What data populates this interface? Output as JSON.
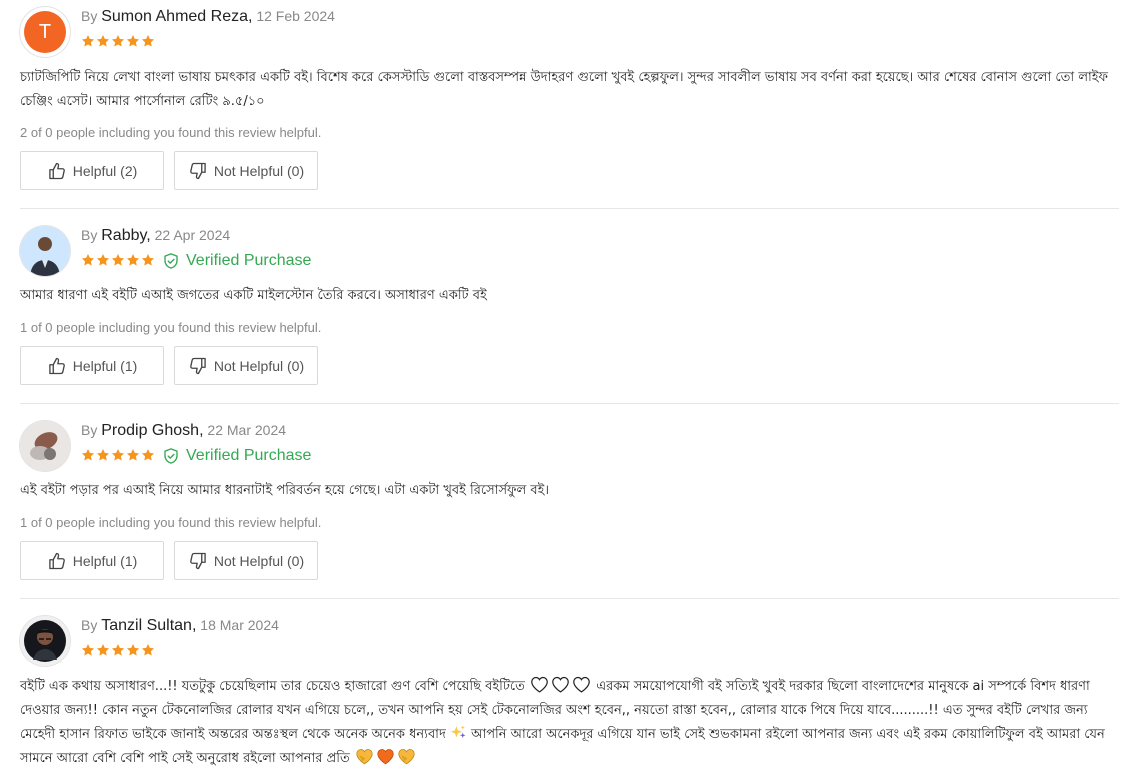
{
  "reviews": [
    {
      "avatar_initial": "T",
      "avatar_color": "#f26522",
      "by": "By",
      "name": "Sumon Ahmed Reza,",
      "date": "12 Feb 2024",
      "rating": 5,
      "verified": "",
      "text": "চ্যাটজিপিটি নিয়ে লেখা বাংলা ভাষায় চমৎকার একটি বই। বিশেষ করে কেসস্টাডি গুলো বাস্তবসম্পন্ন উদাহরণ গুলো খুবই হেল্পফুল। সুন্দর সাবলীল ভাষায় সব বর্ণনা করা হয়েছে। আর শেষের বোনাস গুলো তো লাইফ চেঞ্জিং এসেট। আমার পার্সোনাল রেটিং ৯.৫/১০",
      "helpful_summary": "2 of 0 people including you found this review helpful.",
      "helpful_label": "Helpful (2)",
      "not_helpful_label": "Not Helpful (0)"
    },
    {
      "avatar_initial": "",
      "by": "By",
      "name": "Rabby,",
      "date": "22 Apr 2024",
      "rating": 5,
      "verified": "Verified Purchase",
      "text": "আমার ধারণা এই বইটি এআই জগতের একটি মাইলস্টোন তৈরি করবে। অসাধারণ একটি বই",
      "helpful_summary": "1 of 0 people including you found this review helpful.",
      "helpful_label": "Helpful (1)",
      "not_helpful_label": "Not Helpful (0)"
    },
    {
      "avatar_initial": "",
      "by": "By",
      "name": "Prodip Ghosh,",
      "date": "22 Mar 2024",
      "rating": 5,
      "verified": "Verified Purchase",
      "text": "এই বইটা পড়ার পর এআই নিয়ে আমার ধারনাটাই পরিবর্তন হয়ে গেছে। এটা একটা খুবই রিসোর্সফুল বই।",
      "helpful_summary": "1 of 0 people including you found this review helpful.",
      "helpful_label": "Helpful (1)",
      "not_helpful_label": "Not Helpful (0)"
    },
    {
      "avatar_initial": "",
      "by": "By",
      "name": "Tanzil Sultan,",
      "date": "18 Mar 2024",
      "rating": 5,
      "verified": "",
      "text_part1": "বইটি এক কথায় অসাধারণ...!! যতটুকু চেয়েছিলাম তার চেয়েও হাজারো গুণ বেশি পেয়েছি বইটিতে",
      "text_part2": "এরকম সময়োপযোগী বই সত্যিই খুবই দরকার ছিলো বাংলাদেশের মানুষকে ai সম্পর্কে বিশদ ধারণা দেওয়ার জন্য!! কোন নতুন টেকনোলজির রোলার যখন এগিয়ে চলে,, তখন আপনি হয় সেই টেকনোলজির অংশ হবেন,, নয়তো রাস্তা হবেন,, রোলার যাকে পিষে দিয়ে যাবে.........!! এত সুন্দর বইটি লেখার জন্য মেহেদী হাসান রিফাত ভাইকে জানাই অন্তরের অন্তঃস্থল থেকে অনেক অনেক ধন্যবাদ",
      "text_part3": "আপনি আরো অনেকদূর এগিয়ে যান ভাই সেই শুভকামনা রইলো আপনার জন্য এবং এই রকম কোয়ালিটিফুল বই আমরা যেন সামনে আরো বেশি বেশি পাই সেই অনুরোধ রইলো আপনার প্রতি"
    }
  ],
  "colors": {
    "star": "#f7941d",
    "verified": "#34a853"
  },
  "icons": [
    "star-icon",
    "shield-check-icon",
    "thumbs-up-icon",
    "thumbs-down-icon",
    "heart-outline-icon",
    "sparkles-icon",
    "yellow-heart-icon",
    "orange-heart-icon"
  ]
}
